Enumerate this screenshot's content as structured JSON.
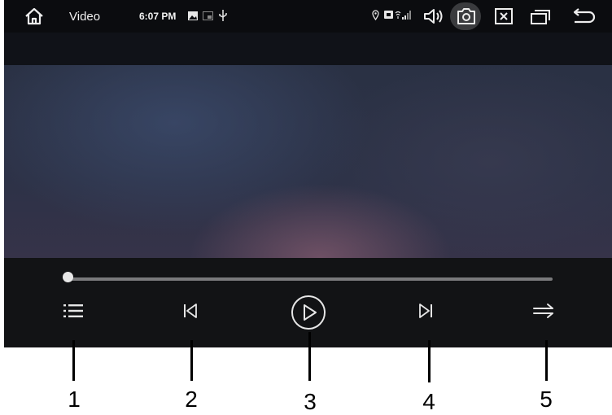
{
  "statusbar": {
    "home_icon": "home-icon",
    "app_title": "Video",
    "time": "6:07 PM",
    "left_icons": [
      "image-icon",
      "cast-icon",
      "usb-icon"
    ],
    "right_icons": [
      "location-icon",
      "sim-icon",
      "wifi-icon",
      "signal-icon"
    ],
    "action_icons": [
      "volume-icon",
      "screenshot-icon",
      "close-app-icon",
      "recent-apps-icon",
      "back-icon"
    ]
  },
  "player": {
    "progress_fraction": 0.0,
    "controls": [
      "playlist-icon",
      "previous-icon",
      "play-icon",
      "next-icon",
      "play-mode-icon"
    ]
  },
  "callouts": [
    "1",
    "2",
    "3",
    "4",
    "5"
  ],
  "colors": {
    "statusbar_bg": "#0b0c0f",
    "controls_bg": "#121315",
    "icon": "#e6e6e6",
    "progress_track": "#7a7a7c",
    "camera_button_bg": "#3a3b3e"
  }
}
